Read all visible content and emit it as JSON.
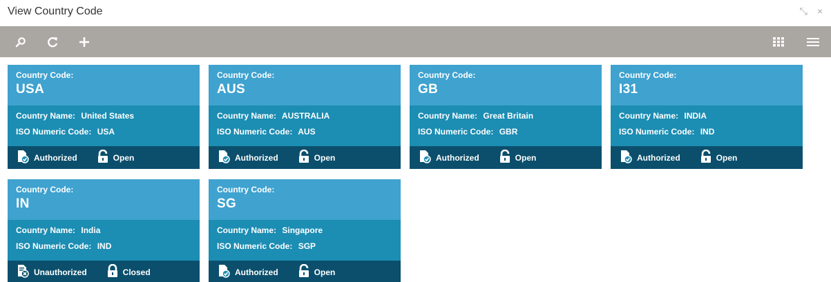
{
  "window": {
    "title": "View Country Code",
    "minimize_glyph": "⤡",
    "close_glyph": "×"
  },
  "toolbar": {
    "left": [
      "search-icon",
      "refresh-icon",
      "add-icon"
    ],
    "right": [
      "grid-view-icon",
      "list-view-icon"
    ]
  },
  "cards": [
    {
      "code_label": "Country Code:",
      "code": "USA",
      "name_label": "Country Name:",
      "name": "United States",
      "iso_label": "ISO Numeric Code:",
      "iso": "USA",
      "auth": "Authorized",
      "status": "Open"
    },
    {
      "code_label": "Country Code:",
      "code": "AUS",
      "name_label": "Country Name:",
      "name": "AUSTRALIA",
      "iso_label": "ISO Numeric Code:",
      "iso": "AUS",
      "auth": "Authorized",
      "status": "Open"
    },
    {
      "code_label": "Country Code:",
      "code": "GB",
      "name_label": "Country Name:",
      "name": "Great Britain",
      "iso_label": "ISO Numeric Code:",
      "iso": "GBR",
      "auth": "Authorized",
      "status": "Open"
    },
    {
      "code_label": "Country Code:",
      "code": "I31",
      "name_label": "Country Name:",
      "name": "INDIA",
      "iso_label": "ISO Numeric Code:",
      "iso": "IND",
      "auth": "Authorized",
      "status": "Open"
    },
    {
      "code_label": "Country Code:",
      "code": "IN",
      "name_label": "Country Name:",
      "name": "India",
      "iso_label": "ISO Numeric Code:",
      "iso": "IND",
      "auth": "Unauthorized",
      "status": "Closed"
    },
    {
      "code_label": "Country Code:",
      "code": "SG",
      "name_label": "Country Name:",
      "name": "Singapore",
      "iso_label": "ISO Numeric Code:",
      "iso": "SGP",
      "auth": "Authorized",
      "status": "Open"
    }
  ],
  "colors": {
    "toolbar": "#aaa7a2",
    "card_head": "#3fa2cf",
    "card_body": "#1c8db3",
    "card_foot": "#0b4f6c"
  }
}
